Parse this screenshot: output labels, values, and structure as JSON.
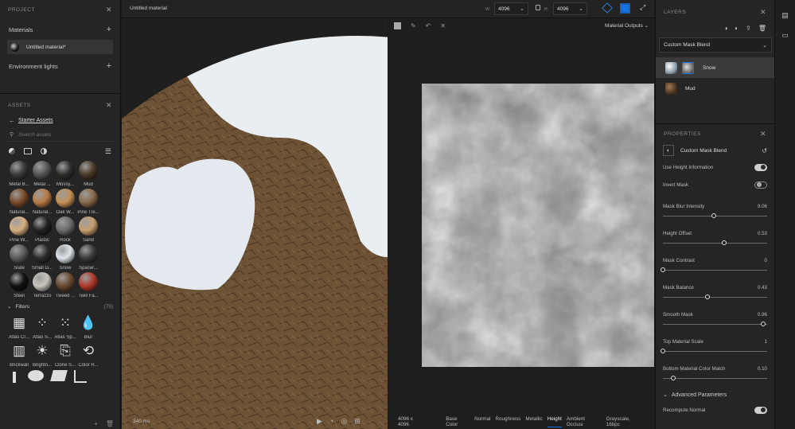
{
  "colors": {
    "accent": "#1473e6",
    "panel": "#252525",
    "snow": "#e9eef2",
    "mud": "#6b4f33"
  },
  "project": {
    "title": "PROJECT",
    "materials_label": "Materials",
    "material_name": "Untitled material*",
    "env_label": "Environment lights"
  },
  "assets": {
    "title": "ASSETS",
    "back_label": "Starter Assets",
    "search_placeholder": "Search assets",
    "items": [
      {
        "label": "Metal B...",
        "color": "#3a3a3a"
      },
      {
        "label": "Metal ...",
        "color": "#555"
      },
      {
        "label": "Mossy...",
        "color": "#2d2f2c"
      },
      {
        "label": "Mud",
        "color": "#4a3a28"
      },
      {
        "label": "Natural...",
        "color": "#7a4a2a"
      },
      {
        "label": "Natural...",
        "color": "#b87a45"
      },
      {
        "label": "Oak W...",
        "color": "#c49055"
      },
      {
        "label": "Pine Tre...",
        "color": "#8a6a4a"
      },
      {
        "label": "Pine W...",
        "color": "#d7b080"
      },
      {
        "label": "Plastic",
        "color": "#222"
      },
      {
        "label": "Rock",
        "color": "#6c6c6c"
      },
      {
        "label": "Sand",
        "color": "#c8a070"
      },
      {
        "label": "Slate",
        "color": "#5a5a5a"
      },
      {
        "label": "Small G...",
        "color": "#2c2c2c"
      },
      {
        "label": "Snow",
        "color": "#dde4ea"
      },
      {
        "label": "Spacer...",
        "color": "#3a3a3a"
      },
      {
        "label": "Steel",
        "color": "#111"
      },
      {
        "label": "Terrazzo",
        "color": "#c9c5bd"
      },
      {
        "label": "Tweed ...",
        "color": "#6a4a30"
      },
      {
        "label": "Twill Fa...",
        "color": "#b03a2a"
      }
    ],
    "filters_label": "Filters",
    "filters_count": "(75)",
    "filters": [
      {
        "label": "Atlas Cr...",
        "icon": "checker-icon"
      },
      {
        "label": "Atlas S...",
        "icon": "dots-icon"
      },
      {
        "label": "Atlas Sp...",
        "icon": "scatter-icon"
      },
      {
        "label": "Blur",
        "icon": "drop-icon"
      },
      {
        "label": "Brickwall",
        "icon": "brick-icon"
      },
      {
        "label": "Brightn...",
        "icon": "sun-icon"
      },
      {
        "label": "Clone S...",
        "icon": "stamp-icon"
      },
      {
        "label": "Color R...",
        "icon": "replace-icon"
      }
    ]
  },
  "topbar": {
    "title": "Untitled material",
    "w_label": "W:",
    "w_value": "4096",
    "h_label": "H:",
    "h_value": "4096"
  },
  "viewport": {
    "status": "340 ms"
  },
  "view2d": {
    "outputs_label": "Material Outputs",
    "resolution": "4096 x 4096",
    "channels": [
      "Base Color",
      "Normal",
      "Roughness",
      "Metallic",
      "Height",
      "Ambient Occlusi"
    ],
    "active_channel": "Height",
    "format": "Grayscale, 16bpc"
  },
  "layers": {
    "title": "LAYERS",
    "blend_mode": "Custom Mask Blend",
    "items": [
      {
        "name": "Snow",
        "selected": true
      },
      {
        "name": "Mud",
        "selected": false
      }
    ]
  },
  "properties": {
    "title": "PROPERTIES",
    "node_name": "Custom Mask Blend",
    "use_height_label": "Use Height Information",
    "use_height_on": true,
    "invert_label": "Invert Mask",
    "invert_on": false,
    "sliders": [
      {
        "label": "Mask Blur Intensity",
        "value": "9.06",
        "frac": 0.49
      },
      {
        "label": "Height Offset",
        "value": "0.53",
        "frac": 0.59
      },
      {
        "label": "Mask Contrast",
        "value": "0",
        "frac": 0.0
      },
      {
        "label": "Mask Balance",
        "value": "0.43",
        "frac": 0.43
      },
      {
        "label": "Smooth Mask",
        "value": "0.96",
        "frac": 0.96
      },
      {
        "label": "Top Material Scale",
        "value": "1",
        "frac": 0.0
      },
      {
        "label": "Bottom Material Color Match",
        "value": "0.10",
        "frac": 0.1
      }
    ],
    "advanced_label": "Advanced Parameters",
    "recompute_label": "Recompute Normal",
    "recompute_on": true
  }
}
